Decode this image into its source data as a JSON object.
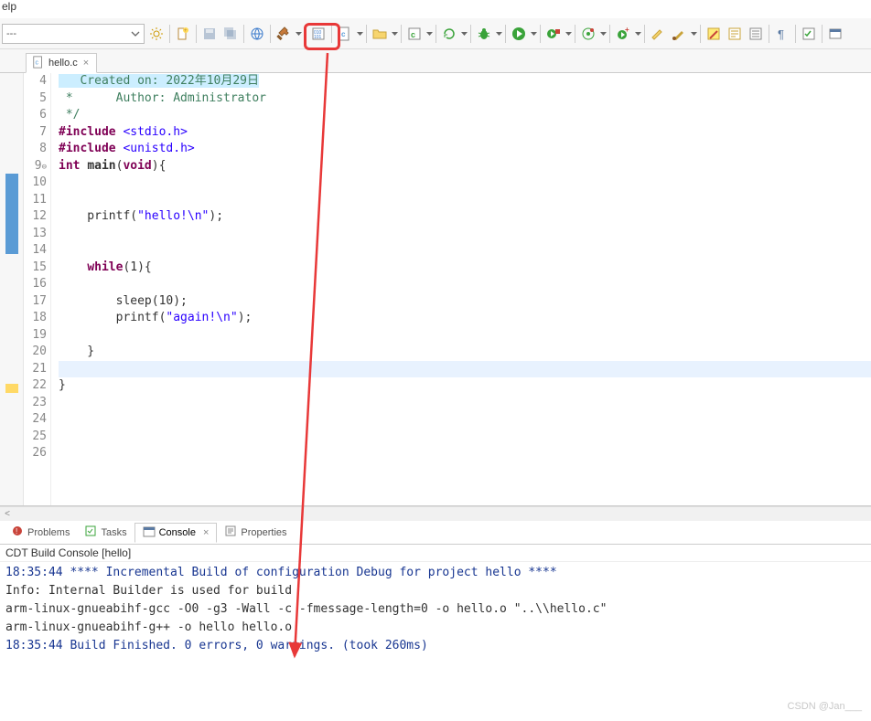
{
  "menu_fragment": "elp",
  "combo_text": "---",
  "toolbar_icons": [
    "gear-icon",
    "sep",
    "new-file-icon",
    "sep",
    "save-icon",
    "save-all-icon",
    "sep",
    "globe-icon",
    "sep",
    "hammer-icon",
    "dd",
    "sep",
    "binary-icon",
    "sep",
    "c-file-icon",
    "dd",
    "sep",
    "folder-icon",
    "dd",
    "sep",
    "c-launch-icon",
    "dd",
    "sep",
    "refresh-icon",
    "dd",
    "sep",
    "bug1-icon",
    "dd",
    "sep",
    "run-icon",
    "dd",
    "sep",
    "run-ext-icon",
    "dd",
    "sep",
    "target-icon",
    "dd",
    "sep",
    "add-run-icon",
    "dd",
    "sep",
    "paint-icon",
    "brush-icon",
    "dd",
    "sep",
    "highlight-icon",
    "form-icon",
    "list-icon",
    "sep",
    "pilcrow-icon",
    "sep",
    "task-icon",
    "sep",
    "picker-icon"
  ],
  "tab": {
    "label": "hello.c"
  },
  "code_start_line": 4,
  "code_lines": [
    {
      "t": "cmt-hl",
      "text": "   Created on: 2022年10月29日"
    },
    {
      "t": "cmt",
      "text": " *      Author: Administrator"
    },
    {
      "t": "cmt",
      "text": " */"
    },
    {
      "t": "inc",
      "prefix": "#include ",
      "hdr": "<stdio.h>"
    },
    {
      "t": "inc",
      "prefix": "#include ",
      "hdr": "<unistd.h>"
    },
    {
      "t": "main",
      "text": ""
    },
    {
      "t": "plain",
      "text": ""
    },
    {
      "t": "plain",
      "text": ""
    },
    {
      "t": "printf",
      "indent": "    ",
      "arg": "\"hello!\\n\""
    },
    {
      "t": "plain",
      "text": ""
    },
    {
      "t": "plain",
      "text": ""
    },
    {
      "t": "while",
      "indent": "    "
    },
    {
      "t": "plain",
      "text": ""
    },
    {
      "t": "call",
      "indent": "        ",
      "name": "sleep",
      "arg": "10"
    },
    {
      "t": "printf",
      "indent": "        ",
      "arg": "\"again!\\n\""
    },
    {
      "t": "plain",
      "text": ""
    },
    {
      "t": "plain",
      "text": "    }"
    },
    {
      "t": "plain",
      "text": "",
      "hl": true
    },
    {
      "t": "plain",
      "text": "}"
    },
    {
      "t": "plain",
      "text": ""
    },
    {
      "t": "plain",
      "text": ""
    },
    {
      "t": "plain",
      "text": ""
    },
    {
      "t": "plain",
      "text": ""
    }
  ],
  "bottom_tabs": [
    {
      "id": "problems",
      "label": "Problems",
      "active": false
    },
    {
      "id": "tasks",
      "label": "Tasks",
      "active": false
    },
    {
      "id": "console",
      "label": "Console",
      "active": true,
      "closable": true
    },
    {
      "id": "properties",
      "label": "Properties",
      "active": false
    }
  ],
  "console_header": "CDT Build Console [hello]",
  "console_lines": [
    {
      "c": "blue",
      "text": "18:35:44 **** Incremental Build of configuration Debug for project hello ****"
    },
    {
      "c": "",
      "text": "Info: Internal Builder is used for build"
    },
    {
      "c": "",
      "text": "arm-linux-gnueabihf-gcc -O0 -g3 -Wall -c -fmessage-length=0 -o hello.o \"..\\\\hello.c\""
    },
    {
      "c": "",
      "text": "arm-linux-gnueabihf-g++ -o hello hello.o"
    },
    {
      "c": "",
      "text": ""
    },
    {
      "c": "blue",
      "text": "18:35:44 Build Finished. 0 errors, 0 warnings. (took 260ms)"
    }
  ],
  "watermark": "CSDN @Jan___"
}
